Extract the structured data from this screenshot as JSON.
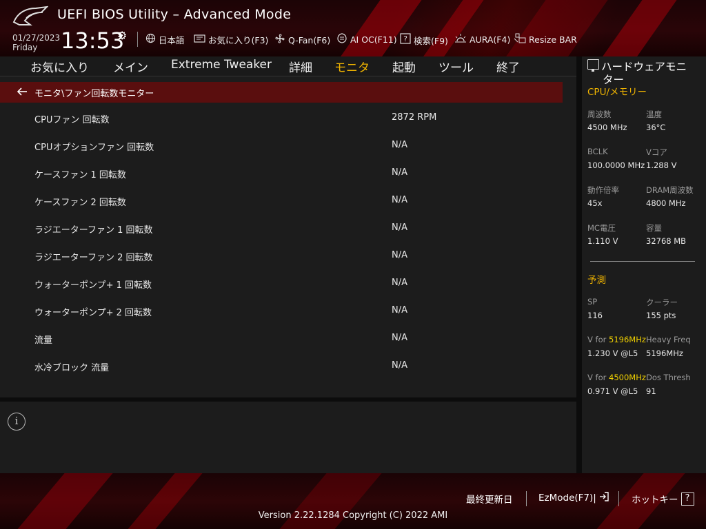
{
  "header": {
    "title": "UEFI BIOS Utility – Advanced Mode",
    "date": "01/27/2023",
    "weekday": "Friday",
    "time": "13:53",
    "toolbar": [
      {
        "icon": "globe-icon",
        "label": "日本語"
      },
      {
        "icon": "bookmark-icon",
        "label": "お気に入り(F3)"
      },
      {
        "icon": "fan-icon",
        "label": "Q-Fan(F6)"
      },
      {
        "icon": "ai-chip-icon",
        "label": "AI OC(F11)"
      },
      {
        "icon": "question-icon",
        "label": "検索(F9)"
      },
      {
        "icon": "aura-light-icon",
        "label": "AURA(F4)"
      },
      {
        "icon": "resize-bar-icon",
        "label": "Resize BAR"
      }
    ]
  },
  "menu": {
    "tabs": [
      {
        "label": "お気に入り"
      },
      {
        "label": "メイン"
      },
      {
        "label": "Extreme Tweaker"
      },
      {
        "label": "詳細"
      },
      {
        "label": "モニタ",
        "active": true
      },
      {
        "label": "起動"
      },
      {
        "label": "ツール"
      },
      {
        "label": "終了"
      }
    ]
  },
  "main": {
    "breadcrumb": "モニタ\\ファン回転数モニター",
    "rows": [
      {
        "label": "CPUファン 回転数",
        "value": "2872 RPM"
      },
      {
        "label": "CPUオプションファン 回転数",
        "value": "N/A"
      },
      {
        "label": "ケースファン 1 回転数",
        "value": "N/A"
      },
      {
        "label": "ケースファン 2 回転数",
        "value": "N/A"
      },
      {
        "label": "ラジエーターファン 1 回転数",
        "value": "N/A"
      },
      {
        "label": "ラジエーターファン 2 回転数",
        "value": "N/A"
      },
      {
        "label": "ウォーターポンプ+ 1 回転数",
        "value": "N/A"
      },
      {
        "label": "ウォーターポンプ+ 2 回転数",
        "value": "N/A"
      },
      {
        "label": "流量",
        "value": "N/A"
      },
      {
        "label": "水冷ブロック 流量",
        "value": "N/A"
      }
    ]
  },
  "hw_monitor": {
    "title_line1": "ハードウェアモニ",
    "title_line2": "ター",
    "cpu_mem": {
      "title": "CPU/メモリー",
      "items": [
        {
          "key": "周波数",
          "value": "4500 MHz"
        },
        {
          "key": "温度",
          "value": "36°C"
        },
        {
          "key": "BCLK",
          "value": "100.0000 MHz"
        },
        {
          "key": "Vコア",
          "value": "1.288 V"
        },
        {
          "key": "動作倍率",
          "value": "45x"
        },
        {
          "key": "DRAM周波数",
          "value": "4800 MHz"
        },
        {
          "key": "MC電圧",
          "value": "1.110 V"
        },
        {
          "key": "容量",
          "value": "32768 MB"
        }
      ]
    },
    "prediction": {
      "title": "予測",
      "sp_key": "SP",
      "sp_value": "116",
      "cooler_key": "クーラー",
      "cooler_value": "155 pts",
      "v1_prefix": "V for ",
      "v1_freq": "5196MHz",
      "v1_value": "1.230 V @L5",
      "heavy_key": "Heavy Freq",
      "heavy_value": "5196MHz",
      "v2_prefix": "V for ",
      "v2_freq": "4500MHz",
      "v2_value": "0.971 V @L5",
      "dos_key": "Dos Thresh",
      "dos_value": "91"
    }
  },
  "footer": {
    "last_modified": "最終更新日",
    "ezmode": "EzMode(F7)|",
    "hotkeys": "ホットキー",
    "hotkey_icon": "?",
    "version": "Version 2.22.1284 Copyright (C) 2022 AMI"
  },
  "colors": {
    "accent": "#f0b400",
    "breadcrumb_bg": "#5a0e0e",
    "highlight": "#f0d000"
  }
}
